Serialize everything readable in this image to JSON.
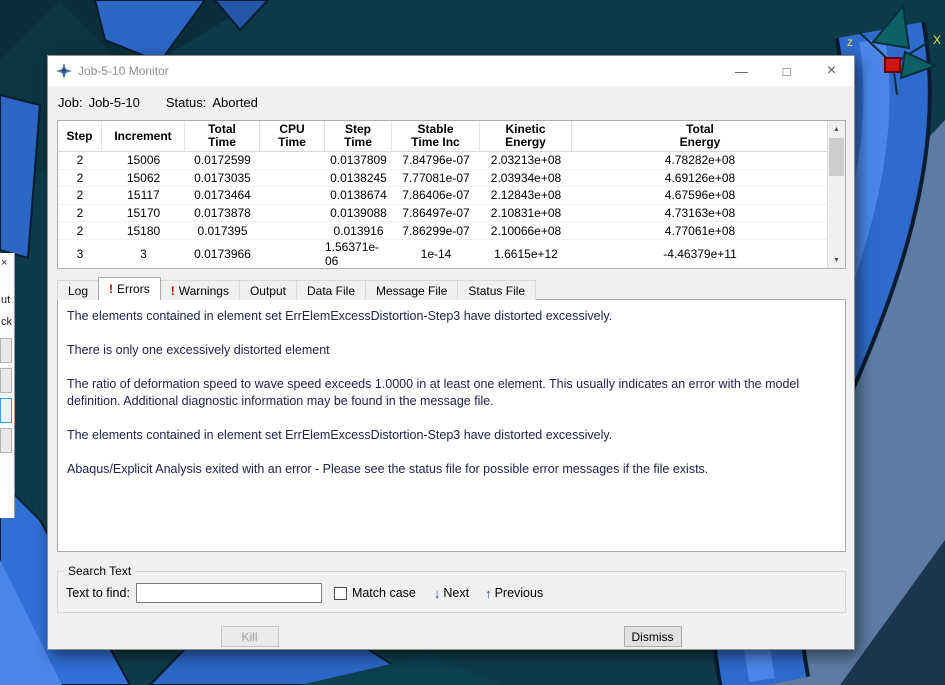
{
  "window": {
    "title": "Job-5-10 Monitor",
    "job_label": "Job:",
    "job_value": "Job-5-10",
    "status_label": "Status:",
    "status_value": "Aborted"
  },
  "table": {
    "headers": [
      [
        "Step",
        ""
      ],
      [
        "Increment",
        ""
      ],
      [
        "Total",
        "Time"
      ],
      [
        "CPU",
        "Time"
      ],
      [
        "Step",
        "Time"
      ],
      [
        "Stable",
        "Time Inc"
      ],
      [
        "Kinetic",
        "Energy"
      ],
      [
        "Total",
        "Energy"
      ]
    ],
    "rows": [
      [
        "2",
        "15006",
        "0.0172599",
        "",
        "0.0137809",
        "7.84796e-07",
        "2.03213e+08",
        "4.78282e+08"
      ],
      [
        "2",
        "15062",
        "0.0173035",
        "",
        "0.0138245",
        "7.77081e-07",
        "2.03934e+08",
        "4.69126e+08"
      ],
      [
        "2",
        "15117",
        "0.0173464",
        "",
        "0.0138674",
        "7.86406e-07",
        "2.12843e+08",
        "4.67596e+08"
      ],
      [
        "2",
        "15170",
        "0.0173878",
        "",
        "0.0139088",
        "7.86497e-07",
        "2.10831e+08",
        "4.73163e+08"
      ],
      [
        "2",
        "15180",
        "0.017395",
        "",
        "0.013916",
        "7.86299e-07",
        "2.10066e+08",
        "4.77061e+08"
      ],
      [
        "3",
        "3",
        "0.0173966",
        "",
        "1.56371e-06",
        "1e-14",
        "1.6615e+12",
        "-4.46379e+11"
      ]
    ]
  },
  "tabs": [
    {
      "label": "Log",
      "error": false,
      "active": false
    },
    {
      "label": "Errors",
      "error": true,
      "active": true
    },
    {
      "label": "Warnings",
      "error": true,
      "active": false
    },
    {
      "label": "Output",
      "error": false,
      "active": false
    },
    {
      "label": "Data File",
      "error": false,
      "active": false
    },
    {
      "label": "Message File",
      "error": false,
      "active": false
    },
    {
      "label": "Status File",
      "error": false,
      "active": false
    }
  ],
  "errors": {
    "paragraphs": [
      "The elements contained in element set ErrElemExcessDistortion-Step3 have distorted excessively.",
      "There is only one excessively distorted element",
      "The ratio of deformation speed to wave speed exceeds 1.0000 in at least one element. This usually indicates an error with the model definition. Additional diagnostic information may be found in the message file.",
      "The elements contained in element set ErrElemExcessDistortion-Step3 have distorted excessively.",
      "Abaqus/Explicit Analysis exited with an error - Please see the  status file for possible error messages if the file exists."
    ]
  },
  "search": {
    "group_label": "Search Text",
    "find_label": "Text to find:",
    "input_value": "",
    "match_case_label": "Match case",
    "next_label": "Next",
    "previous_label": "Previous"
  },
  "buttons": {
    "kill": "Kill",
    "dismiss": "Dismiss"
  },
  "icons": {
    "error_bang": "!",
    "minimize": "—",
    "maximize": "□",
    "close": "×",
    "next_arrow": "↓",
    "previous_arrow": "↑",
    "scroll_up": "▲",
    "scroll_down": "▼"
  },
  "background": {
    "left_labels": [
      "×",
      "ut",
      "ck"
    ],
    "triad": {
      "z_label": "z",
      "x_label": "X"
    }
  },
  "colors": {
    "error_accent": "#c00000",
    "viewport_background": "#0e3b49",
    "model_blue": "#2e6bcc",
    "triad_teal": "#0d5f68",
    "axis_label_yellow": "#e6e64a",
    "highlight_border": "#3d9bff"
  }
}
